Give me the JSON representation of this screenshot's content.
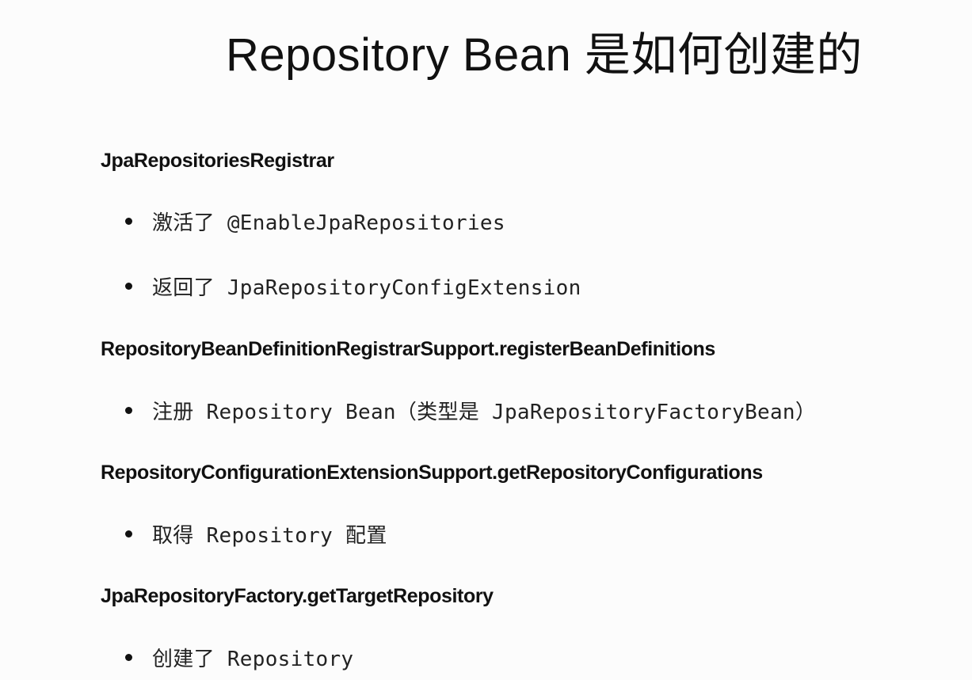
{
  "slide": {
    "title": "Repository Bean 是如何创建的",
    "sections": [
      {
        "heading": "JpaRepositoriesRegistrar",
        "bullets": [
          "激活了 @EnableJpaRepositories",
          "返回了 JpaRepositoryConfigExtension"
        ]
      },
      {
        "heading": "RepositoryBeanDefinitionRegistrarSupport.registerBeanDefinitions",
        "bullets": [
          "注册 Repository Bean（类型是 JpaRepositoryFactoryBean）"
        ]
      },
      {
        "heading": "RepositoryConfigurationExtensionSupport.getRepositoryConfigurations",
        "bullets": [
          "取得 Repository 配置"
        ]
      },
      {
        "heading": "JpaRepositoryFactory.getTargetRepository",
        "bullets": [
          "创建了 Repository"
        ]
      }
    ]
  }
}
